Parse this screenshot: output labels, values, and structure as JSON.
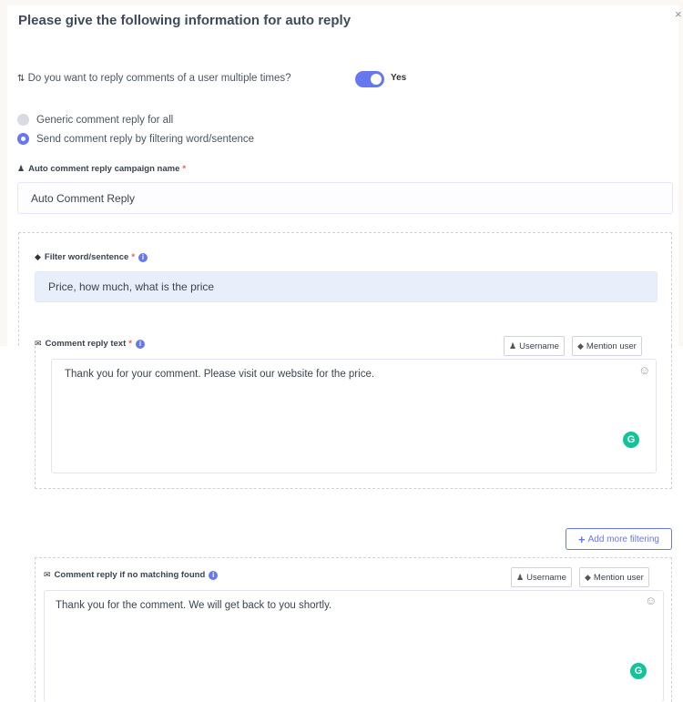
{
  "header": {
    "title": "Please give the following information for auto reply",
    "close_label": "×"
  },
  "multi_reply": {
    "icon": "sort-icon",
    "question": "Do you want to reply comments of a user multiple times?",
    "toggle_state": "on",
    "toggle_label": "Yes"
  },
  "reply_mode": {
    "options": [
      {
        "label": "Generic comment reply for all",
        "selected": false
      },
      {
        "label": "Send comment reply by filtering word/sentence",
        "selected": true
      }
    ]
  },
  "campaign": {
    "label": "Auto comment reply campaign name",
    "required_mark": "*",
    "value": "Auto Comment Reply"
  },
  "filter_block": {
    "filter_label": "Filter word/sentence",
    "required_mark": "*",
    "filter_value": "Price, how much, what is the price",
    "reply_label": "Comment reply text",
    "reply_value": "Thank you for your comment. Please visit our website for the price.",
    "username_btn": "Username",
    "mention_btn": "Mention user"
  },
  "add_filter_button": "Add more filtering",
  "no_match_block": {
    "label": "Comment reply if no matching found",
    "value": "Thank you for the comment. We will get back to you shortly.",
    "username_btn": "Username",
    "mention_btn": "Mention user"
  },
  "colors": {
    "accent": "#6777ef",
    "required": "#fc544b",
    "grammarly": "#15c39a",
    "filled_input": "#e9eefb"
  },
  "icons": {
    "info": "info-icon",
    "user": "user-icon",
    "tag": "tags-icon",
    "envelope": "envelope-icon",
    "smile": "smile-icon",
    "grammarly": "grammarly-icon",
    "plus": "plus-icon",
    "campaign": "campaign-icon"
  }
}
